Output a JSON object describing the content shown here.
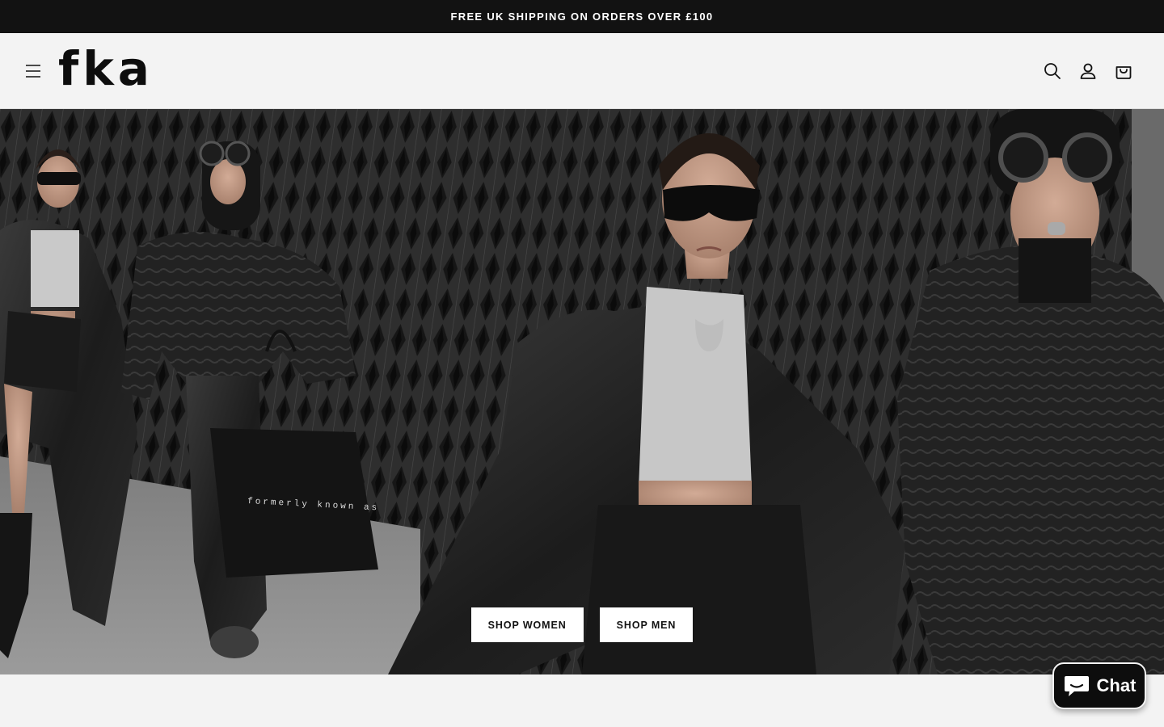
{
  "announcement": {
    "text": "FREE UK SHIPPING ON ORDERS OVER £100"
  },
  "header": {
    "logo_text": "fka",
    "icons": {
      "menu": "hamburger-menu-icon",
      "search": "search-icon",
      "account": "account-icon",
      "cart": "shopping-bag-icon"
    }
  },
  "hero": {
    "bag_print": "formerly known as",
    "buttons": {
      "women_label": "SHOP WOMEN",
      "men_label": "SHOP MEN"
    }
  },
  "chat": {
    "label": "Chat",
    "icon": "chat-bubble-icon"
  },
  "colors": {
    "announcement_bg": "#121212",
    "page_bg": "#f3f3f3",
    "button_bg": "#ffffff",
    "chat_bg": "#0d0d0d"
  }
}
